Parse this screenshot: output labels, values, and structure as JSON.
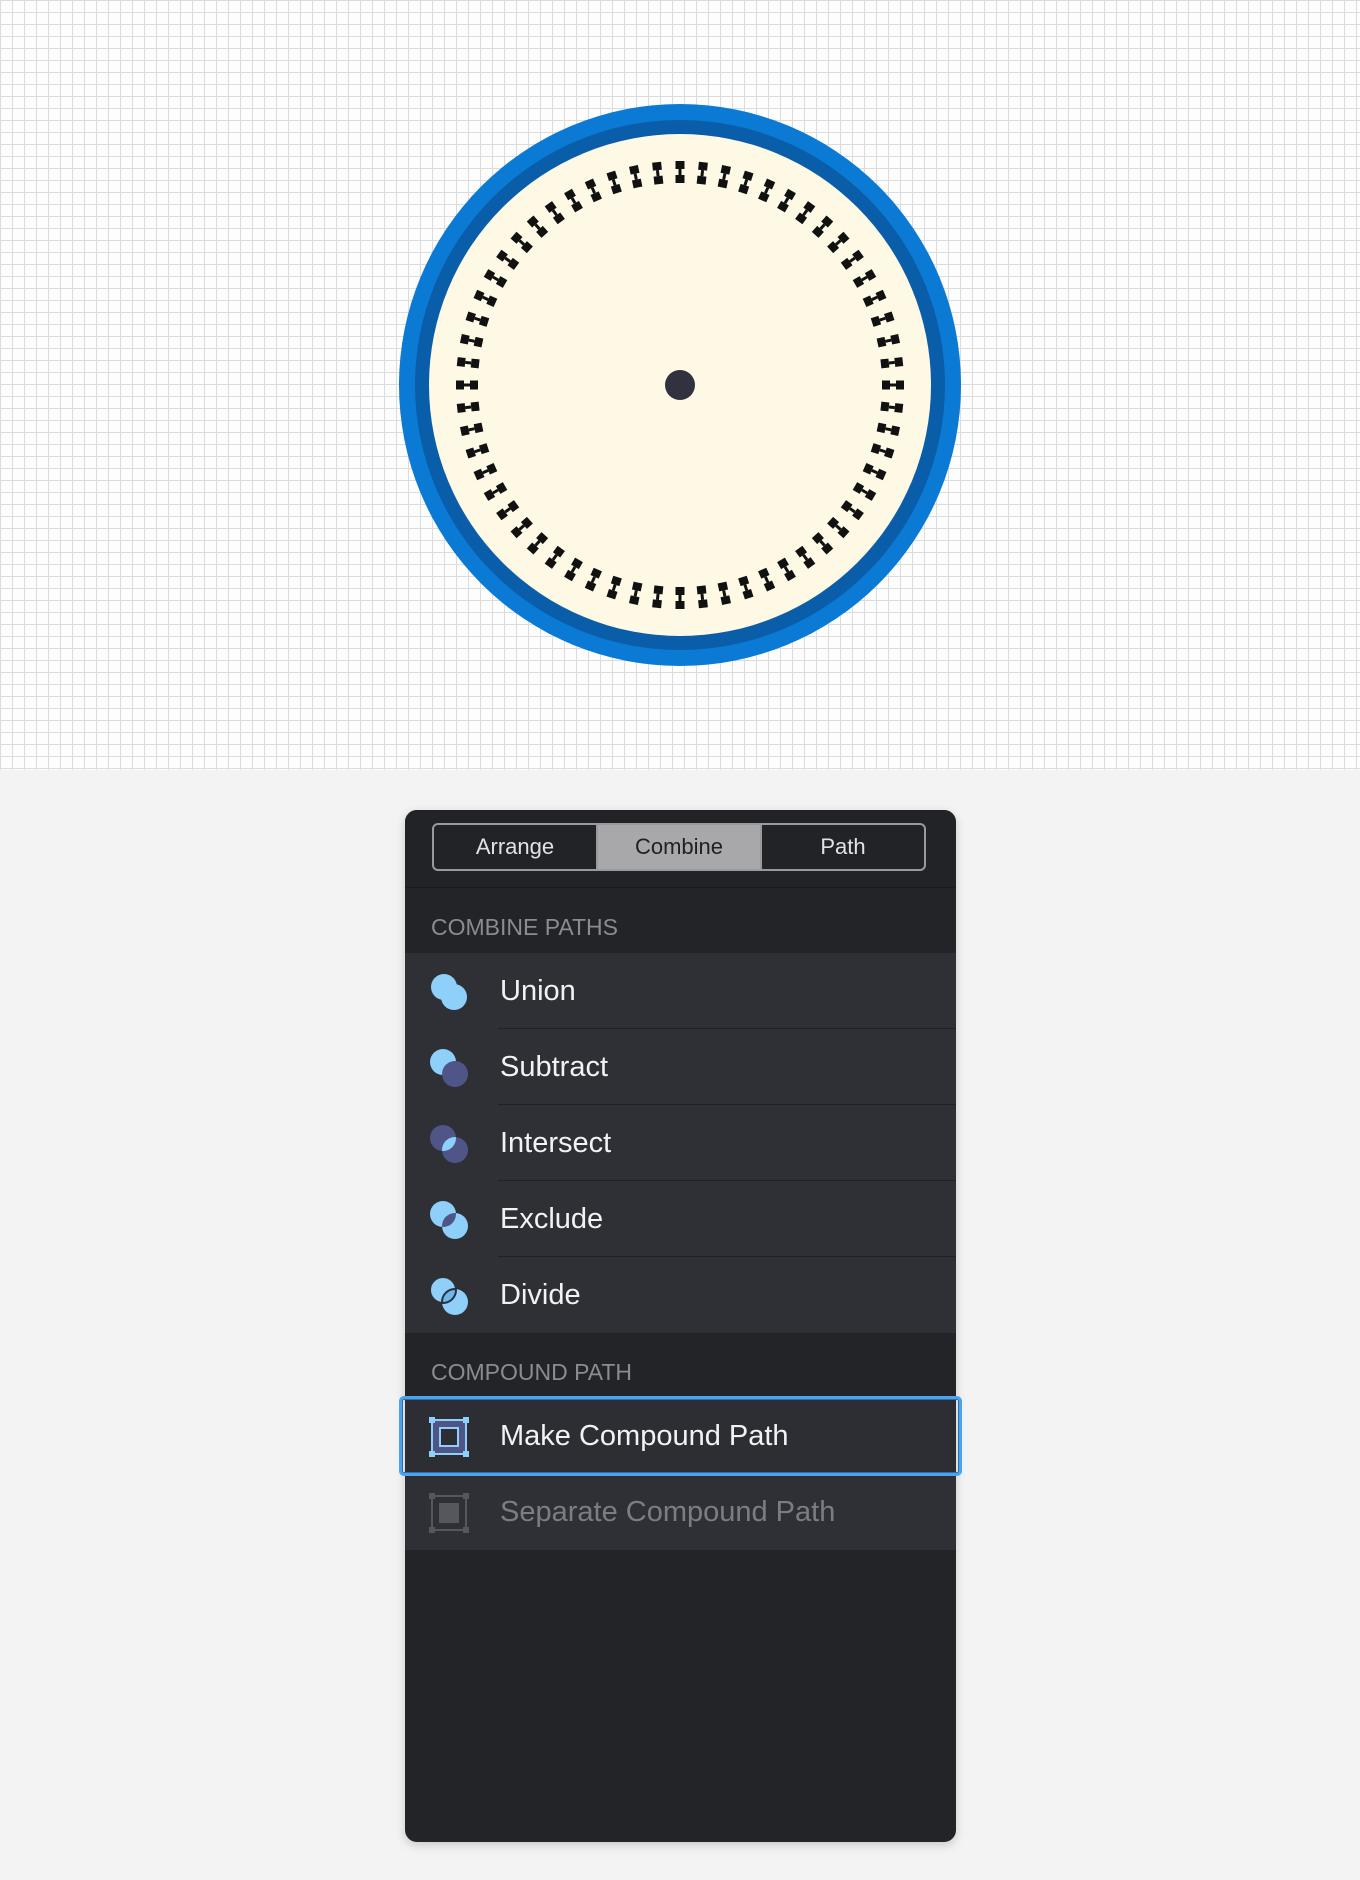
{
  "canvas": {
    "grid_color": "#dcdcdc",
    "dial": {
      "outer_ring_color": "#0a7ad4",
      "inner_ring_color": "#0a5da8",
      "face_color": "#fdf9e4",
      "tick_color": "#111111",
      "center_dot_color": "#32313f",
      "tick_count": 60
    }
  },
  "panel": {
    "tabs": [
      {
        "label": "Arrange",
        "active": false
      },
      {
        "label": "Combine",
        "active": true
      },
      {
        "label": "Path",
        "active": false
      }
    ],
    "combine_section": {
      "header": "COMBINE PATHS",
      "items": [
        {
          "label": "Union",
          "icon": "union-icon"
        },
        {
          "label": "Subtract",
          "icon": "subtract-icon"
        },
        {
          "label": "Intersect",
          "icon": "intersect-icon"
        },
        {
          "label": "Exclude",
          "icon": "exclude-icon"
        },
        {
          "label": "Divide",
          "icon": "divide-icon"
        }
      ]
    },
    "compound_section": {
      "header": "COMPOUND PATH",
      "items": [
        {
          "label": "Make Compound Path",
          "icon": "make-compound-path-icon",
          "selected": true,
          "enabled": true
        },
        {
          "label": "Separate Compound Path",
          "icon": "separate-compound-path-icon",
          "selected": false,
          "enabled": false
        }
      ]
    },
    "colors": {
      "accent": "#4ba3ea",
      "icon_light": "#8fd0fb",
      "icon_dark": "#4f5587"
    }
  }
}
